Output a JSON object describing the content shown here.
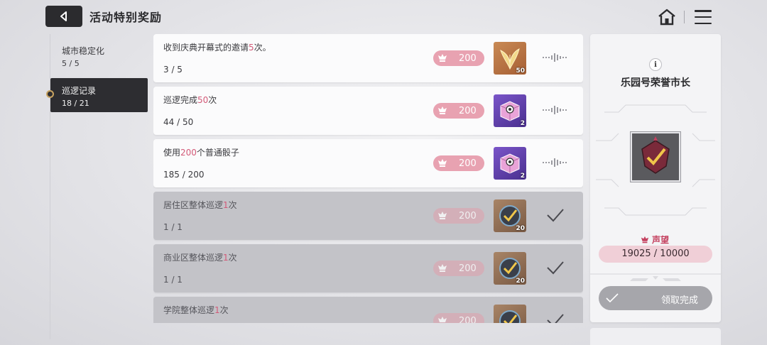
{
  "header": {
    "title": "活动特别奖励"
  },
  "sidebar": {
    "items": [
      {
        "label": "城市稳定化",
        "count": "5 / 5",
        "active": false
      },
      {
        "label": "巡逻记录",
        "count": "18 / 21",
        "active": true
      }
    ]
  },
  "tasks": [
    {
      "pre": "收到庆典开幕式的邀请",
      "hl": "5",
      "post": "次。",
      "progress": "3 / 5",
      "reward": "200",
      "item_qty": "50",
      "item_icon": "golden-leaf-icon",
      "status": "in-progress"
    },
    {
      "pre": "巡逻完成",
      "hl": "50",
      "post": "次",
      "progress": "44 / 50",
      "reward": "200",
      "item_qty": "2",
      "item_icon": "dice-icon",
      "status": "in-progress"
    },
    {
      "pre": "使用",
      "hl": "200",
      "post": "个普通骰子",
      "progress": "185 / 200",
      "reward": "200",
      "item_qty": "2",
      "item_icon": "dice-icon",
      "status": "in-progress"
    },
    {
      "pre": "居住区整体巡逻",
      "hl": "1",
      "post": "次",
      "progress": "1 / 1",
      "reward": "200",
      "item_qty": "20",
      "item_icon": "badge-check-icon",
      "status": "completed"
    },
    {
      "pre": "商业区整体巡逻",
      "hl": "1",
      "post": "次",
      "progress": "1 / 1",
      "reward": "200",
      "item_qty": "20",
      "item_icon": "badge-check-icon",
      "status": "completed"
    },
    {
      "pre": "学院整体巡逻",
      "hl": "1",
      "post": "次",
      "progress": "",
      "reward": "200",
      "item_qty": "",
      "item_icon": "badge-check-icon",
      "status": "completed"
    }
  ],
  "panel": {
    "title": "乐园号荣誉市长",
    "reputation_label": "声望",
    "reputation_value": "19025 / 10000",
    "claim_label": "领取完成"
  },
  "colors": {
    "accent_pink": "#d35a78",
    "pill_pink": "#e8a2b1",
    "dark": "#2d2d31"
  }
}
